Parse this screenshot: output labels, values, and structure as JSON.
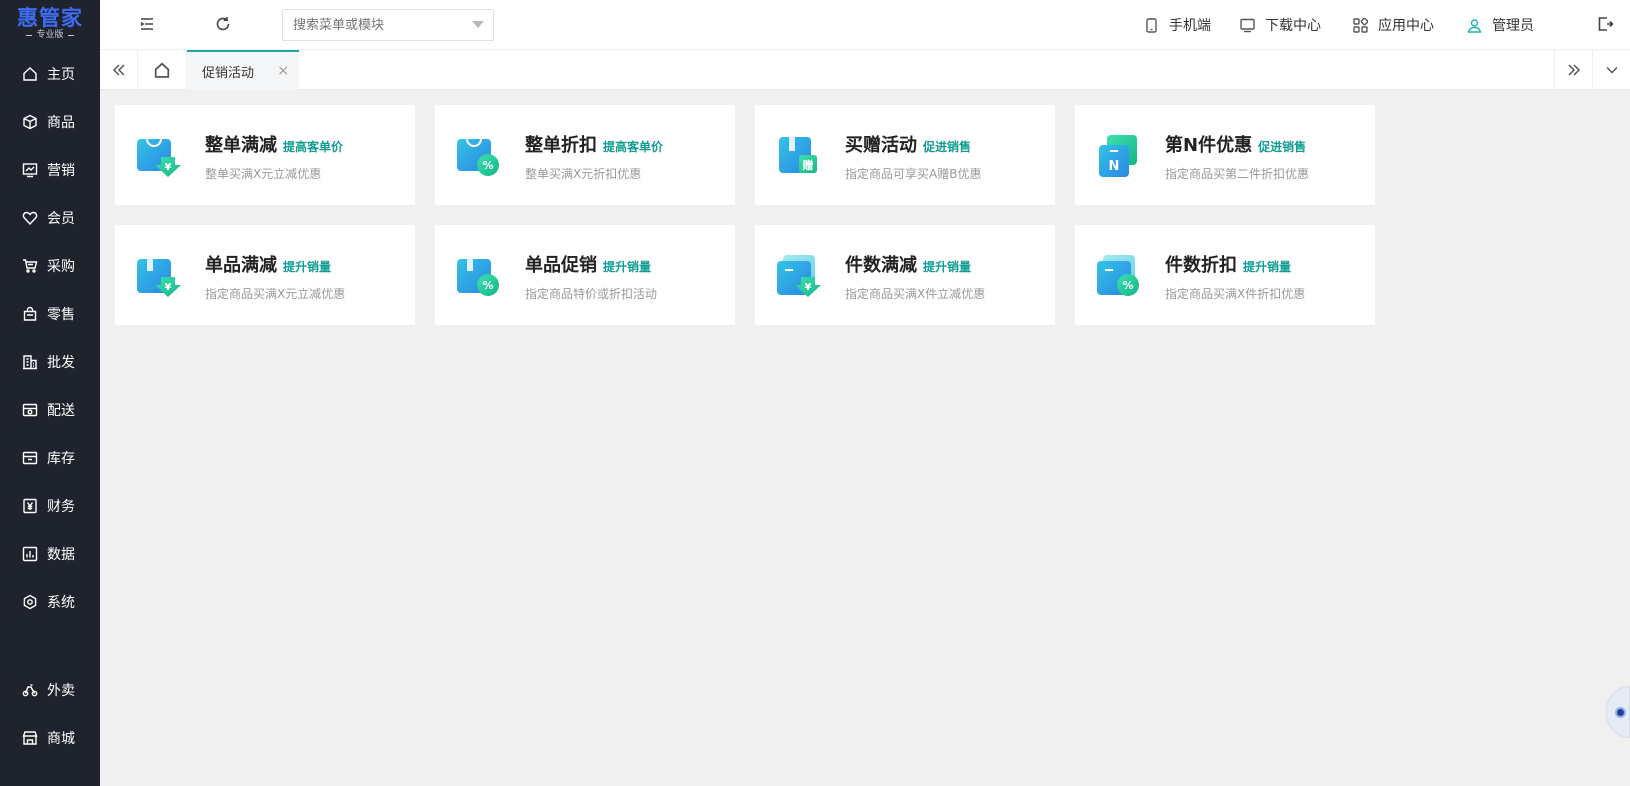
{
  "app": {
    "logo": "惠管家",
    "edition": "专业版"
  },
  "sidebar": {
    "items": [
      {
        "label": "主页",
        "icon": "home-icon"
      },
      {
        "label": "商品",
        "icon": "box-icon"
      },
      {
        "label": "营销",
        "icon": "chart-icon"
      },
      {
        "label": "会员",
        "icon": "heart-icon"
      },
      {
        "label": "采购",
        "icon": "cart-icon"
      },
      {
        "label": "零售",
        "icon": "bag-icon"
      },
      {
        "label": "批发",
        "icon": "building-icon"
      },
      {
        "label": "配送",
        "icon": "delivery-icon"
      },
      {
        "label": "库存",
        "icon": "warehouse-icon"
      },
      {
        "label": "财务",
        "icon": "yuan-icon"
      },
      {
        "label": "数据",
        "icon": "data-icon"
      },
      {
        "label": "系统",
        "icon": "settings-icon"
      }
    ],
    "bottom_items": [
      {
        "label": "外卖",
        "icon": "bike-icon"
      },
      {
        "label": "商城",
        "icon": "store-icon"
      }
    ]
  },
  "header": {
    "search_placeholder": "搜索菜单或模块",
    "mobile_label": "手机端",
    "download_label": "下载中心",
    "apps_label": "应用中心",
    "user_label": "管理员"
  },
  "tabs": {
    "active_label": "促销活动",
    "close_glyph": "×"
  },
  "colors": {
    "sidebar_bg": "#1f232d",
    "accent": "#20a7a0",
    "tag": "#139c91",
    "logo": "#3d6cf0"
  },
  "cards": [
    {
      "title": "整单满减",
      "tag": "提高客单价",
      "desc": "整单买满X元立减优惠",
      "icon": "bag-yuan-icon"
    },
    {
      "title": "整单折扣",
      "tag": "提高客单价",
      "desc": "整单买满X元折扣优惠",
      "icon": "bag-percent-icon"
    },
    {
      "title": "买赠活动",
      "tag": "促进销售",
      "desc": "指定商品可享买A赠B优惠",
      "icon": "gift-icon"
    },
    {
      "title": "第N件优惠",
      "tag": "促进销售",
      "desc": "指定商品买第二件折扣优惠",
      "icon": "nth-item-icon"
    },
    {
      "title": "单品满减",
      "tag": "提升销量",
      "desc": "指定商品买满X元立减优惠",
      "icon": "item-yuan-icon"
    },
    {
      "title": "单品促销",
      "tag": "提升销量",
      "desc": "指定商品特价或折扣活动",
      "icon": "item-percent-icon"
    },
    {
      "title": "件数满减",
      "tag": "提升销量",
      "desc": "指定商品买满X件立减优惠",
      "icon": "qty-yuan-icon"
    },
    {
      "title": "件数折扣",
      "tag": "提升销量",
      "desc": "指定商品买满X件折扣优惠",
      "icon": "qty-percent-icon"
    }
  ]
}
